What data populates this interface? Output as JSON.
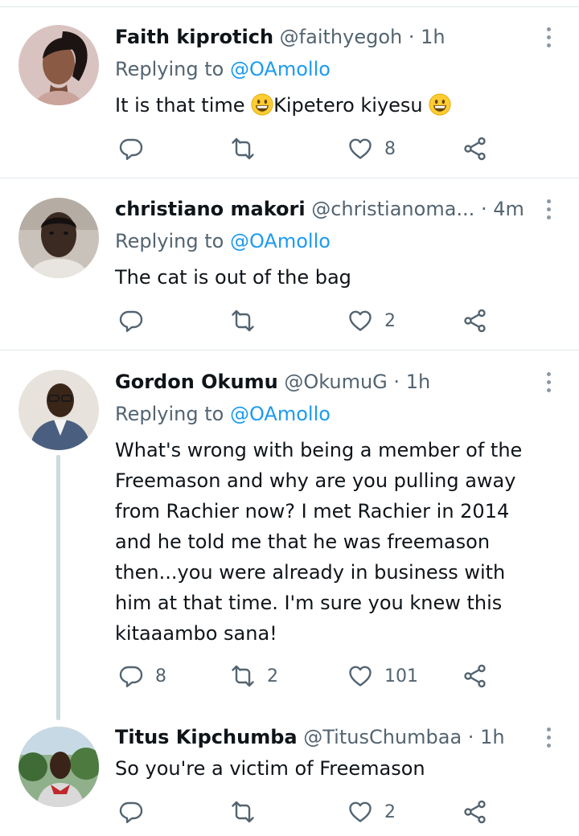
{
  "tweets": [
    {
      "name": "Faith kiprotich",
      "handle": "@faithyegoh",
      "separator": "·",
      "time": "1h",
      "replying_prefix": "Replying to",
      "replying_to": "@OAmollo",
      "text_part1": "It is that time ",
      "text_part2": "Kipetero kiyesu ",
      "reply_count": "",
      "retweet_count": "",
      "like_count": "8"
    },
    {
      "name": "christiano makori",
      "handle": "@christianoma...",
      "separator": "·",
      "time": "4m",
      "replying_prefix": "Replying to",
      "replying_to": "@OAmollo",
      "text": "The cat is out of the bag",
      "reply_count": "",
      "retweet_count": "",
      "like_count": "2"
    },
    {
      "name": "Gordon Okumu",
      "handle": "@OkumuG",
      "separator": "·",
      "time": "1h",
      "replying_prefix": "Replying to",
      "replying_to": "@OAmollo",
      "text_lines": [
        "What's wrong with being a member of the",
        "Freemason and why are you pulling away",
        "from Rachier now? I met Rachier in 2014",
        "and he told me that he was freemason",
        "then...you were already in business with",
        "him at that time. I'm sure you knew this",
        "kitaaambo sana!"
      ],
      "reply_count": "8",
      "retweet_count": "2",
      "like_count": "101"
    },
    {
      "name": "Titus Kipchumba",
      "handle": "@TitusChumbaa",
      "separator": "·",
      "time": "1h",
      "text": "So you're a victim of Freemason",
      "reply_count": "",
      "retweet_count": "",
      "like_count": "2"
    }
  ],
  "icons": {
    "reply": "reply-icon",
    "retweet": "retweet-icon",
    "like": "heart-icon",
    "share": "share-icon",
    "more": "more-vertical-icon",
    "emoji": "grinning-face-emoji"
  },
  "colors": {
    "link": "#1d9bf0",
    "secondary_text": "#536471",
    "divider": "#e1e8ed"
  }
}
